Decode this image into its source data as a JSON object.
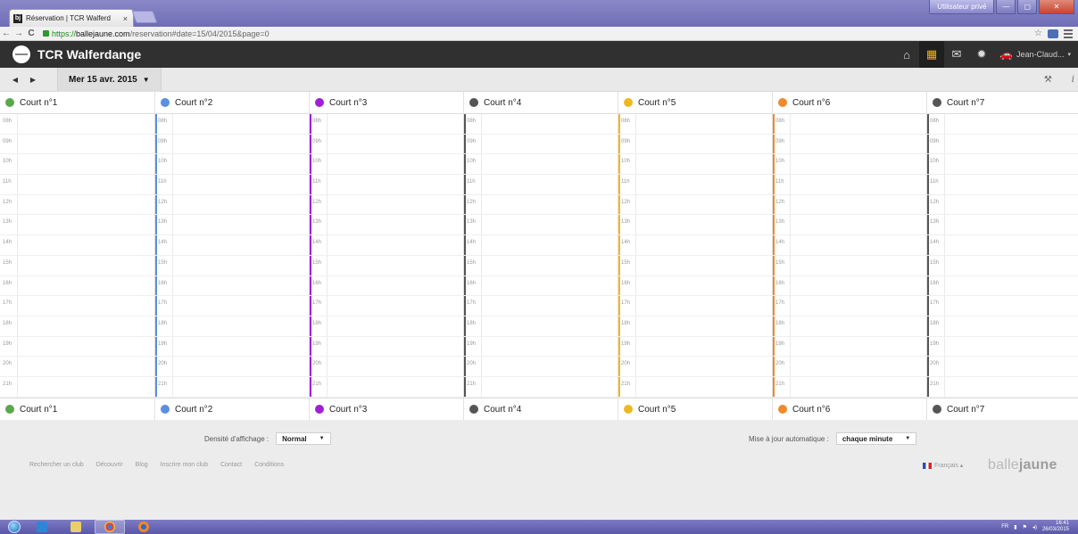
{
  "browser": {
    "tab_title": "Réservation | TCR Walferd",
    "tab_close": "×",
    "tab_favicon": "bj",
    "url_https": "https://",
    "url_domain": "ballejaune.com",
    "url_path": "/reservation#date=15/04/2015&page=0",
    "window_user": "Utilisateur privé",
    "nav_back": "←",
    "nav_forward": "→",
    "nav_reload": "C",
    "win_minimize": "—",
    "win_maximize": "▢",
    "win_close": "✕",
    "star_icon": "☆"
  },
  "app": {
    "club_name": "TCR Walferdange",
    "user_name": "Jean-Claud...",
    "icons": [
      "home-icon",
      "calendar-icon",
      "mail-icon",
      "gear-icon"
    ],
    "icon_glyphs": {
      "home": "⌂",
      "calendar": "▦",
      "mail": "✉",
      "gear": "✹",
      "car": "🚗"
    },
    "active_icon": "calendar-icon",
    "user_caret": "▾"
  },
  "datebar": {
    "prev": "◀",
    "next": "▶",
    "date_label": "Mer 15 avr. 2015",
    "caret": "▼",
    "tools_icon": "⚒",
    "info_icon": "i"
  },
  "calendar": {
    "hours": [
      "08h",
      "09h",
      "10h",
      "11h",
      "12h",
      "13h",
      "14h",
      "15h",
      "16h",
      "17h",
      "18h",
      "19h",
      "20h",
      "21h"
    ],
    "courts": [
      {
        "name": "Court n°1",
        "color": "#5aa84a"
      },
      {
        "name": "Court n°2",
        "color": "#5b8fe0"
      },
      {
        "name": "Court n°3",
        "color": "#a020d8"
      },
      {
        "name": "Court n°4",
        "color": "#555555"
      },
      {
        "name": "Court n°5",
        "color": "#f0b820"
      },
      {
        "name": "Court n°6",
        "color": "#ee8a2a"
      },
      {
        "name": "Court n°7",
        "color": "#555555"
      }
    ]
  },
  "footer": {
    "density_label": "Densité d'affichage :",
    "density_value": "Normal",
    "autoupdate_label": "Mise à jour automatique :",
    "autoupdate_value": "chaque minute",
    "select_caret": "▼",
    "links": [
      "Rechercher un club",
      "Découvrir",
      "Blog",
      "Inscrire mon club",
      "Contact",
      "Conditions"
    ],
    "language": "Français ▴",
    "brand_light": "balle",
    "brand_bold": "jaune"
  },
  "taskbar": {
    "lang": "FR",
    "time": "16:41",
    "date": "26/03/2015"
  }
}
